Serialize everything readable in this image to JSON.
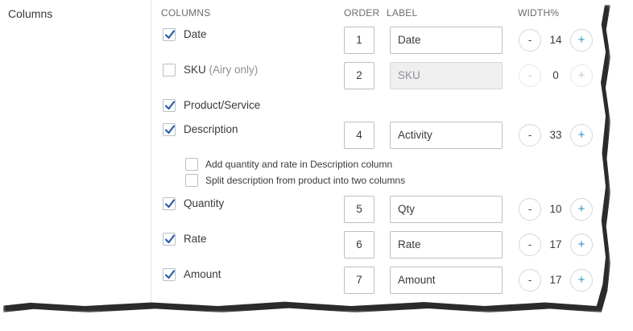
{
  "section_title": "Columns",
  "headers": {
    "columns": "COLUMNS",
    "order": "ORDER",
    "label": "LABEL",
    "width": "WIDTH%"
  },
  "rows": [
    {
      "name": "Date",
      "suffix": "",
      "checked": true,
      "order": "1",
      "label": "Date",
      "width": "14",
      "minus": "-",
      "plus": "+"
    },
    {
      "name": "SKU",
      "suffix": "(Airy only)",
      "checked": false,
      "order": "2",
      "label": "SKU",
      "width": "0",
      "minus": "-",
      "plus": "+"
    },
    {
      "name": "Product/Service",
      "suffix": "",
      "checked": true
    },
    {
      "name": "Description",
      "suffix": "",
      "checked": true,
      "order": "4",
      "label": "Activity",
      "width": "33",
      "minus": "-",
      "plus": "+"
    },
    {
      "name": "Quantity",
      "suffix": "",
      "checked": true,
      "order": "5",
      "label": "Qty",
      "width": "10",
      "minus": "-",
      "plus": "+"
    },
    {
      "name": "Rate",
      "suffix": "",
      "checked": true,
      "order": "6",
      "label": "Rate",
      "width": "17",
      "minus": "-",
      "plus": "+"
    },
    {
      "name": "Amount",
      "suffix": "",
      "checked": true,
      "order": "7",
      "label": "Amount",
      "width": "17",
      "minus": "-",
      "plus": "+"
    }
  ],
  "sub_options": [
    {
      "label": "Add quantity and rate in Description column",
      "checked": false
    },
    {
      "label": "Split description from product into two columns",
      "checked": false
    }
  ],
  "colors": {
    "checkmark": "#2c5ca8",
    "plus": "#2c8bc3",
    "disabled_field": "#efefef"
  }
}
